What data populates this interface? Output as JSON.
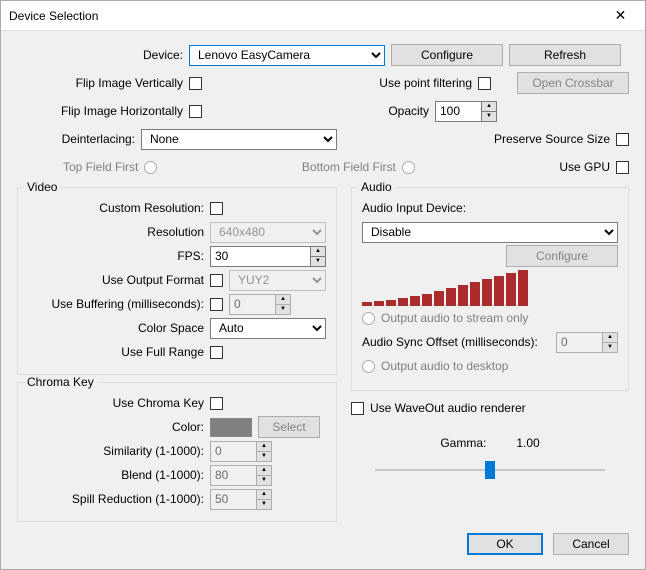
{
  "window": {
    "title": "Device Selection"
  },
  "top": {
    "device_label": "Device:",
    "device_value": "Lenovo EasyCamera",
    "configure": "Configure",
    "refresh": "Refresh",
    "flip_vert": "Flip Image Vertically",
    "point_filter": "Use point filtering",
    "open_crossbar": "Open Crossbar",
    "flip_horiz": "Flip Image Horizontally",
    "opacity_label": "Opacity",
    "opacity_value": "100",
    "deinterlacing_label": "Deinterlacing:",
    "deinterlacing_value": "None",
    "preserve_size": "Preserve Source Size",
    "top_field": "Top Field First",
    "bottom_field": "Bottom Field First",
    "use_gpu": "Use GPU"
  },
  "video": {
    "legend": "Video",
    "custom_res": "Custom Resolution:",
    "resolution_label": "Resolution",
    "resolution_value": "640x480",
    "fps_label": "FPS:",
    "fps_value": "30",
    "output_format_label": "Use Output Format",
    "output_format_value": "YUY2",
    "buffering_label": "Use Buffering (milliseconds):",
    "buffering_value": "0",
    "color_space_label": "Color Space",
    "color_space_value": "Auto",
    "full_range": "Use Full Range"
  },
  "chroma": {
    "legend": "Chroma Key",
    "use_chroma": "Use Chroma Key",
    "color_label": "Color:",
    "select_btn": "Select",
    "similarity_label": "Similarity (1-1000):",
    "similarity_value": "0",
    "blend_label": "Blend (1-1000):",
    "blend_value": "80",
    "spill_label": "Spill Reduction (1-1000):",
    "spill_value": "50"
  },
  "audio": {
    "legend": "Audio",
    "input_label": "Audio Input Device:",
    "input_value": "Disable",
    "configure": "Configure",
    "stream_only": "Output audio to stream only",
    "sync_label": "Audio Sync Offset (milliseconds):",
    "sync_value": "0",
    "to_desktop": "Output audio to desktop",
    "waveout": "Use WaveOut audio renderer"
  },
  "gamma": {
    "label": "Gamma:",
    "value": "1.00"
  },
  "footer": {
    "ok": "OK",
    "cancel": "Cancel"
  }
}
